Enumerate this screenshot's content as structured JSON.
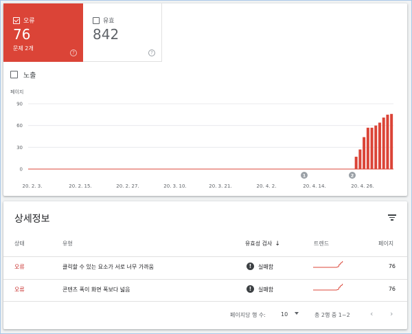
{
  "summary": {
    "error": {
      "label": "오류",
      "value": "76",
      "sub": "문제 2개",
      "help": "?"
    },
    "valid": {
      "label": "유효",
      "value": "842",
      "help": "?"
    },
    "impressions_label": "노출"
  },
  "chart_data": {
    "type": "bar",
    "ylabel": "페이지",
    "y_ticks": [
      "0",
      "30",
      "60",
      "90"
    ],
    "ylim": [
      0,
      90
    ],
    "x_ticks": [
      "20. 2. 3.",
      "20. 2. 15.",
      "20. 2. 27.",
      "20. 3. 10.",
      "20. 3. 21.",
      "20. 4. 2.",
      "20. 4. 14.",
      "20. 4. 26."
    ],
    "markers": [
      "1",
      "2"
    ],
    "color": "#db4437",
    "grid": true,
    "values": [
      0,
      0,
      0,
      0,
      0,
      0,
      0,
      0,
      0,
      0,
      0,
      0,
      0,
      0,
      0,
      0,
      0,
      0,
      0,
      0,
      0,
      0,
      0,
      0,
      0,
      0,
      0,
      0,
      0,
      0,
      0,
      0,
      0,
      0,
      0,
      0,
      0,
      0,
      0,
      0,
      0,
      0,
      0,
      0,
      0,
      0,
      0,
      0,
      0,
      0,
      0,
      0,
      0,
      0,
      0,
      0,
      0,
      0,
      0,
      0,
      0,
      0,
      0,
      0,
      0,
      0,
      0,
      0,
      0,
      0,
      0,
      0,
      0,
      0,
      0,
      0,
      0,
      0,
      0,
      0,
      0,
      0,
      0,
      17,
      27,
      44,
      57,
      57,
      60,
      64,
      71,
      75,
      76
    ]
  },
  "details": {
    "title": "상세정보",
    "columns": {
      "status": "상태",
      "type": "유형",
      "validation": "유효성 검사",
      "trend": "트렌드",
      "pages": "페이지"
    },
    "rows": [
      {
        "status": "오류",
        "type": "클릭할 수 있는 요소가 서로 너무 가까움",
        "validation": "실패함",
        "pages": "76"
      },
      {
        "status": "오류",
        "type": "콘텐츠 폭이 화면 폭보다 넓음",
        "validation": "실패함",
        "pages": "76"
      }
    ],
    "pager": {
      "rows_per_page_label": "페이지당 행 수:",
      "rows_per_page": "10",
      "range": "총 2행 중 1~2"
    }
  },
  "colors": {
    "error": "#db4437",
    "accent_text": "#c5221f"
  }
}
